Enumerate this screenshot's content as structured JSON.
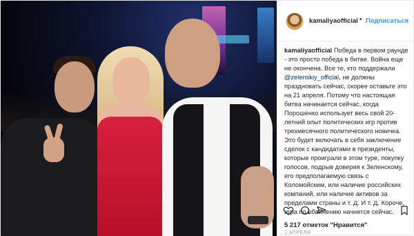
{
  "post": {
    "username": "kamaliyaofficial",
    "separator": "•",
    "follow_label": "Подписаться",
    "caption": {
      "username": "kamaliyaofficial",
      "text_before": "Победа в первом раунде - это просто победа в битве. Война еще не окончена. Все те, кто поддержали",
      "mention": "@zelenskiy_official",
      "text_after": ", не должны праздновать сейчас, скорее оставьте это на 21 апреля. Потому что настоящая битва начинается сейчас, когда Порошенко использует весь свой 20-летний опыт политических игр против трехмесячного политического новичка. Это будет включать в себя заключение сделок с кандидатами в президенты, которые проиграли в этом туре, покупку голосов, подрыв доверия к Зеленскому, его предполагаемую связь с Коломойским, или наличие российских компаний, или наличие активов за пределами страны и т. Д. И т. Д. Короче, игра по обвинению начнется сейчас."
    },
    "likes_text": "5 217 отметок \"Нравится\"",
    "date": "1 АПРЕЛЯ"
  },
  "icons": {
    "like": "heart-outline-icon",
    "comment": "comment-bubble-icon",
    "share": "share-arrow-icon",
    "save": "bookmark-icon"
  }
}
